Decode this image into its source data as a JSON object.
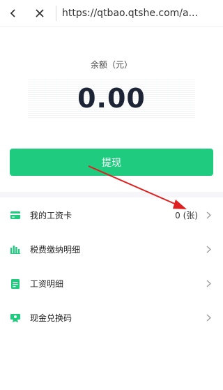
{
  "browser": {
    "url": "https://qtbao.qtshe.com/a..."
  },
  "balance": {
    "label": "余额（元）",
    "amount": "0.00"
  },
  "withdraw": {
    "label": "提现"
  },
  "menu": {
    "items": [
      {
        "label": "我的工资卡",
        "value": "0 (张)",
        "icon": "card-icon"
      },
      {
        "label": "税费缴纳明细",
        "value": "",
        "icon": "tax-chart-icon"
      },
      {
        "label": "工资明细",
        "value": "",
        "icon": "payslip-icon"
      },
      {
        "label": "现金兑换码",
        "value": "",
        "icon": "redeem-icon"
      }
    ]
  },
  "colors": {
    "accent": "#1ecb7f",
    "amount": "#1c2436",
    "annotation_arrow": "#e02020"
  }
}
